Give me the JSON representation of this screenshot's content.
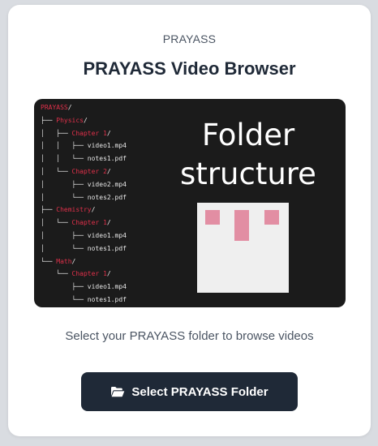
{
  "card": {
    "brand": "PRAYASS",
    "title": "PRAYASS Video Browser",
    "subtitle": "Select your PRAYASS folder to browse videos",
    "button_label": "Select PRAYASS Folder",
    "button_icon": "folder-open-icon"
  },
  "preview": {
    "heading_line1": "Folder",
    "heading_line2": "structure",
    "tree": [
      {
        "prefix": "",
        "name": "PRAYASS",
        "suffix": "/",
        "color": "red"
      },
      {
        "prefix": "├── ",
        "name": "Physics",
        "suffix": "/",
        "color": "red"
      },
      {
        "prefix": "│   ├── ",
        "name": "Chapter 1",
        "suffix": "/",
        "color": "red"
      },
      {
        "prefix": "│   │   ├── ",
        "name": "video1.mp4",
        "suffix": "",
        "color": "white"
      },
      {
        "prefix": "│   │   └── ",
        "name": "notes1.pdf",
        "suffix": "",
        "color": "white"
      },
      {
        "prefix": "│   └── ",
        "name": "Chapter 2",
        "suffix": "/",
        "color": "red"
      },
      {
        "prefix": "│       ├── ",
        "name": "video2.mp4",
        "suffix": "",
        "color": "white"
      },
      {
        "prefix": "│       └── ",
        "name": "notes2.pdf",
        "suffix": "",
        "color": "white"
      },
      {
        "prefix": "├── ",
        "name": "Chemistry",
        "suffix": "/",
        "color": "red"
      },
      {
        "prefix": "│   └── ",
        "name": "Chapter 1",
        "suffix": "/",
        "color": "red"
      },
      {
        "prefix": "│       ├── ",
        "name": "video1.mp4",
        "suffix": "",
        "color": "white"
      },
      {
        "prefix": "│       └── ",
        "name": "notes1.pdf",
        "suffix": "",
        "color": "white"
      },
      {
        "prefix": "└── ",
        "name": "Math",
        "suffix": "/",
        "color": "red"
      },
      {
        "prefix": "    └── ",
        "name": "Chapter 1",
        "suffix": "/",
        "color": "red"
      },
      {
        "prefix": "        ├── ",
        "name": "video1.mp4",
        "suffix": "",
        "color": "white"
      },
      {
        "prefix": "        └── ",
        "name": "notes1.pdf",
        "suffix": "",
        "color": "white"
      }
    ]
  },
  "colors": {
    "page_bg": "#d9dce1",
    "card_bg": "#ffffff",
    "button_bg": "#1f2937",
    "folder_name": "#e0304a",
    "preview_bg": "#1b1b1b",
    "face_accent": "#e28ea3"
  }
}
